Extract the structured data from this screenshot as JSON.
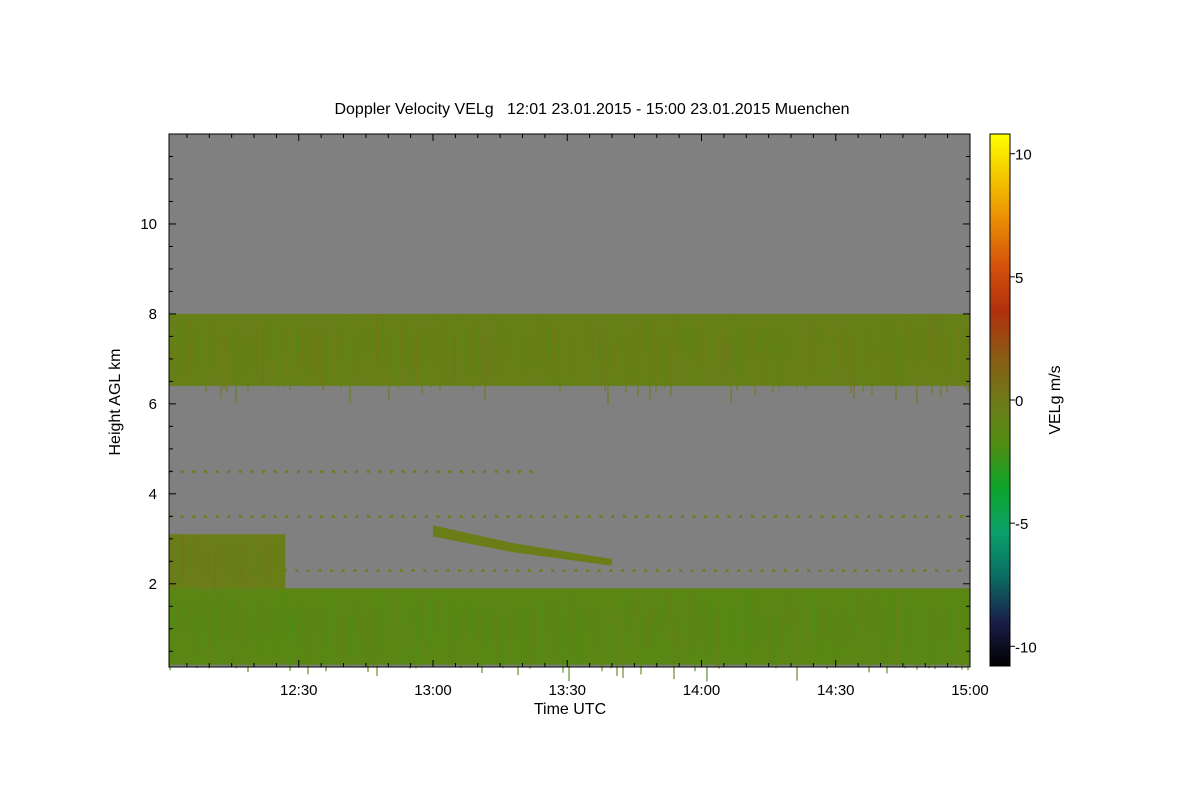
{
  "chart_data": {
    "type": "heatmap",
    "title": "Doppler Velocity VELg   12:01 23.01.2015 - 15:00 23.01.2015 Muenchen",
    "xlabel": "Time UTC",
    "ylabel": "Height AGL km",
    "colorbar_label": "VELg m/s",
    "x_range": [
      "12:01",
      "15:00"
    ],
    "xlim_minutes": [
      721,
      900
    ],
    "ylim": [
      0.15,
      12.0
    ],
    "x_ticks": [
      "12:30",
      "13:00",
      "13:30",
      "14:00",
      "14:30",
      "15:00"
    ],
    "y_ticks": [
      2,
      4,
      6,
      8,
      10
    ],
    "colorbar": {
      "range": [
        -10.8,
        10.8
      ],
      "ticks": [
        10,
        5,
        0,
        -5,
        -10
      ],
      "colors": [
        "#000000",
        "#1a1f4a",
        "#0b6b63",
        "#0aa06a",
        "#0da52c",
        "#4f8c12",
        "#6f7a18",
        "#8a5a14",
        "#b2300c",
        "#d4500c",
        "#e88a05",
        "#f4c400",
        "#ffff00"
      ]
    },
    "background_color": "#808080",
    "layers": [
      {
        "name": "upper cloud",
        "bottom_km": 6.4,
        "top_km": 8.0,
        "velocity_ms": -0.5
      },
      {
        "name": "boundary layer",
        "bottom_km": 0.2,
        "top_km": 1.9,
        "velocity_ms": -1.2
      },
      {
        "name": "lower cloud",
        "start": "12:01",
        "end": "12:27",
        "bottom_km": 1.9,
        "top_km": 3.1,
        "velocity_ms": -0.3
      },
      {
        "name": "sloping layer",
        "start": "13:00",
        "end": "13:40",
        "bottom_km": 2.4,
        "top_km": 3.3,
        "velocity_ms": -0.3
      }
    ]
  }
}
